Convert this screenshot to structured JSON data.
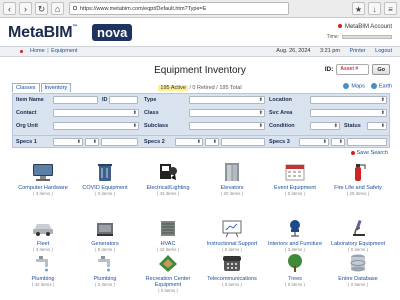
{
  "browser": {
    "url": "https://www.metabim.com/eqpt/Default.htm?Type=E"
  },
  "header": {
    "logo_text": "MetaBIM",
    "logo_tm": "™",
    "product": "nova",
    "account_label": "MetaBIM Account",
    "time_label": "Time:"
  },
  "breadcrumb": {
    "home": "Home",
    "separator": "|",
    "section": "Equipment",
    "date": "Aug. 26, 2024",
    "time": "3:21 pm",
    "printer": "Printer",
    "logout": "Logout"
  },
  "page": {
    "title": "Equipment Inventory",
    "id_label": "ID:",
    "id_placeholder": "Asset #",
    "go_label": "Go"
  },
  "tabs": [
    "Classes",
    "Inventory"
  ],
  "status": {
    "active": "195 Active",
    "retired": "0 Retired",
    "total": "195 Total",
    "sep": " / "
  },
  "links": {
    "maps": "Maps",
    "earth": "Earth"
  },
  "filters": {
    "item_name": "Item Name",
    "id": "ID",
    "type": "Type",
    "location": "Location",
    "contact": "Contact",
    "class": "Class",
    "svc_area": "Svc Area",
    "org_unit": "Org Unit",
    "subclass": "Subclass",
    "condition": "Condition",
    "status_label": "Status",
    "specs1": "Specs 1",
    "specs2": "Specs 2",
    "specs3": "Specs 3",
    "save_search": "Save Search"
  },
  "categories": [
    {
      "label": "Computer Hardware",
      "count": "( 3 items )",
      "icon": "monitor-icon"
    },
    {
      "label": "COVID Equipment",
      "count": "( 0 items )",
      "icon": "trash-bin-icon"
    },
    {
      "label": "Electrical/Lighting",
      "count": "( 43 items )",
      "icon": "electrician-icon"
    },
    {
      "label": "Elevators",
      "count": "( 20 items )",
      "icon": "elevator-icon"
    },
    {
      "label": "Event Equipment",
      "count": "( 0 items )",
      "icon": "calendar-icon"
    },
    {
      "label": "Fire Life and Safety",
      "count": "( 25 items )",
      "icon": "fire-extinguisher-icon"
    },
    {
      "label": "Fleet",
      "count": "( 3 items )",
      "icon": "car-icon"
    },
    {
      "label": "Generators",
      "count": "( 5 items )",
      "icon": "generator-icon"
    },
    {
      "label": "HVAC",
      "count": "( 42 items )",
      "icon": "hvac-icon"
    },
    {
      "label": "Instructional Support",
      "count": "( 0 items )",
      "icon": "whiteboard-icon"
    },
    {
      "label": "Interiors and Furniture",
      "count": "( 3 items )",
      "icon": "chair-icon"
    },
    {
      "label": "Laboratory Equipment",
      "count": "( 0 items )",
      "icon": "microscope-icon"
    },
    {
      "label": "Plumbing",
      "count": "( 42 items )",
      "icon": "faucet-icon"
    },
    {
      "label": "Plumbing",
      "count": "( 0 items )",
      "icon": "faucet-icon"
    },
    {
      "label": "Recreation Center Equipment",
      "count": "( 0 items )",
      "icon": "field-icon"
    },
    {
      "label": "Telecommunications",
      "count": "( 3 items )",
      "icon": "phone-icon"
    },
    {
      "label": "Trees",
      "count": "( 0 items )",
      "icon": "tree-icon"
    },
    {
      "label": "Entire Database",
      "count": "( 0 items )",
      "icon": "database-icon"
    }
  ],
  "colors": {
    "brand": "#1e3360",
    "link": "#1b4d9a",
    "accent_red": "#d6201f",
    "panel": "#d9e3f0"
  }
}
